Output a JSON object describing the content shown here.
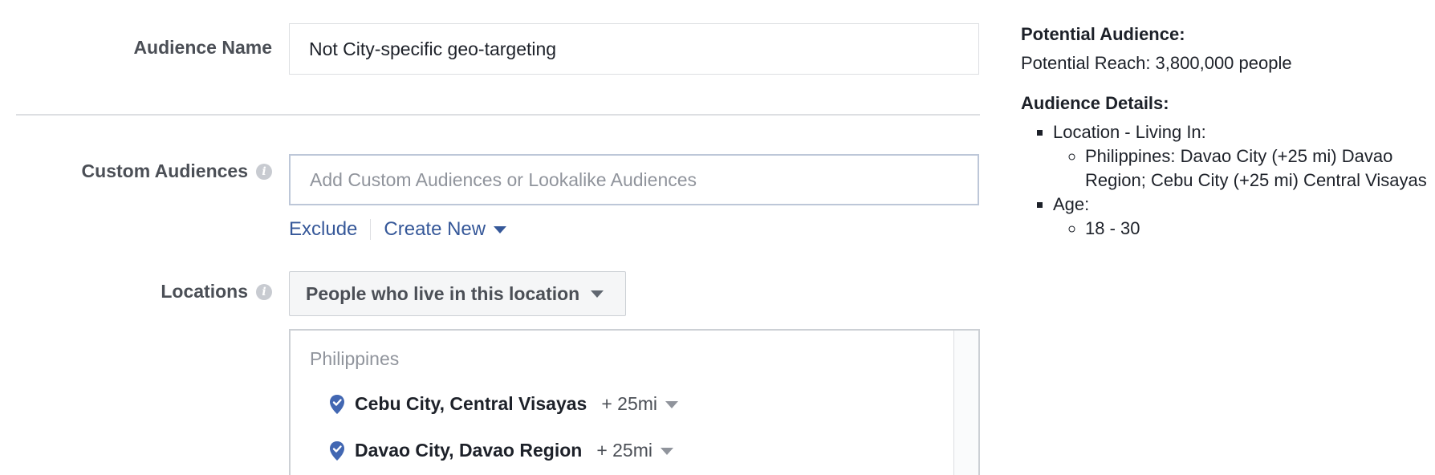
{
  "form": {
    "audience_name_label": "Audience Name",
    "audience_name_value": "Not City-specific geo-targeting",
    "custom_audiences_label": "Custom Audiences",
    "custom_audiences_placeholder": "Add Custom Audiences or Lookalike Audiences",
    "exclude_link": "Exclude",
    "create_new_link": "Create New",
    "locations_label": "Locations",
    "location_mode": "People who live in this location",
    "location_country": "Philippines",
    "locations": [
      {
        "name": "Cebu City, Central Visayas",
        "radius": "+ 25mi"
      },
      {
        "name": "Davao City, Davao Region",
        "radius": "+ 25mi"
      }
    ]
  },
  "summary": {
    "potential_audience_heading": "Potential Audience:",
    "potential_reach": "Potential Reach: 3,800,000 people",
    "audience_details_heading": "Audience Details:",
    "details": [
      {
        "label": "Location - Living In:",
        "items": [
          "Philippines: Davao City (+25 mi) Davao Region; Cebu City (+25 mi) Central Visayas"
        ]
      },
      {
        "label": "Age:",
        "items": [
          "18 - 30"
        ]
      }
    ]
  },
  "colors": {
    "link": "#365899",
    "pin": "#4267b2",
    "label": "#4b4f56",
    "placeholder": "#90949c"
  },
  "icons": {
    "info": "info-icon",
    "pin": "location-pin-icon",
    "caret": "chevron-down-icon"
  }
}
